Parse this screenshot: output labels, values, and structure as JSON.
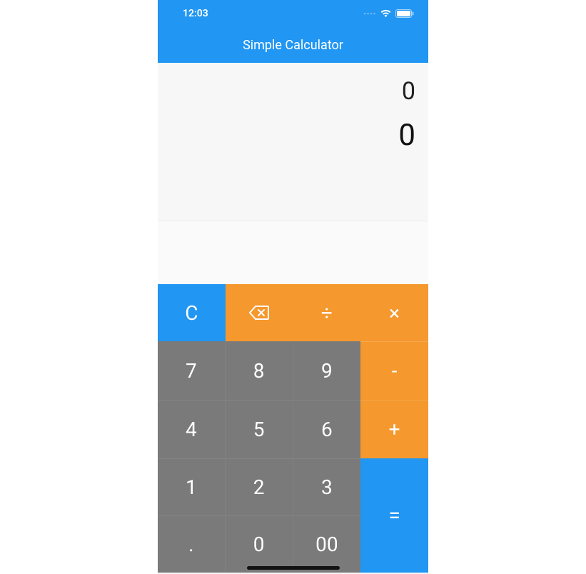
{
  "status": {
    "time": "12:03"
  },
  "header": {
    "title": "Simple Calculator"
  },
  "display": {
    "secondary": "0",
    "primary": "0"
  },
  "keys": {
    "clear": "C",
    "divide": "÷",
    "multiply": "×",
    "subtract": "-",
    "add": "+",
    "equals": "=",
    "seven": "7",
    "eight": "8",
    "nine": "9",
    "four": "4",
    "five": "5",
    "six": "6",
    "one": "1",
    "two": "2",
    "three": "3",
    "decimal": ".",
    "zero": "0",
    "doublezero": "00"
  }
}
